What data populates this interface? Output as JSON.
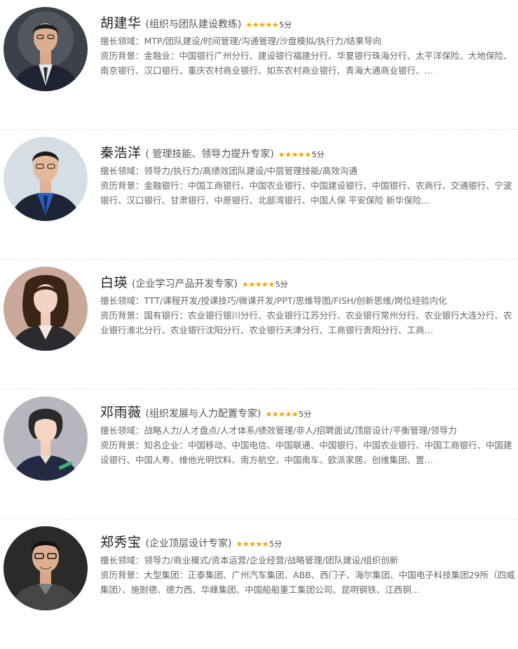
{
  "trainers": [
    {
      "name": "胡建华",
      "title": "(组织与团队建设教练)",
      "stars": "★★★★★",
      "score": "5分",
      "expertise_label": "擅长领域：",
      "expertise": "MTP/团队建设/时间管理/沟通管理/沙盘模拟/执行力/结果导向",
      "background_label": "资历背景：",
      "background": "金融业：中国银行广州分行、建设银行福建分行、华夏银行珠海分行、太平洋保险、大地保险、南京银行、汉口银行、重庆农村商业银行、如东农村商业银行、青海大通商业银行、…"
    },
    {
      "name": "秦浩洋",
      "title": "( 管理技能、领导力提升专家)",
      "stars": "★★★★★",
      "score": "5分",
      "expertise_label": "擅长领域：",
      "expertise": "领导力/执行力/高绩效团队建设/中层管理技能/高效沟通",
      "background_label": "资历背景：",
      "background": "金融银行：中国工商银行、中国农业银行、中国建设银行、中国银行、农商行、交通银行、宁波银行、汉口银行、甘肃银行、中原银行、北部湾银行、中国人保 平安保险 新华保险…"
    },
    {
      "name": "白瑛",
      "title": "(企业学习产品开发专家)",
      "stars": "★★★★★",
      "score": "5分",
      "expertise_label": "擅长领域：",
      "expertise": "TTT/课程开发/授课技巧/微课开发/PPT/思维导图/FISH/创新思维/岗位经验内化",
      "background_label": "资历背景：",
      "background": "国有银行：农业银行银川分行、农业银行江苏分行、农业银行常州分行、农业银行大连分行、农业银行淮北分行、农业银行沈阳分行、农业银行天津分行、工商银行贵阳分行、工商…"
    },
    {
      "name": "邓雨薇",
      "title": "(组织发展与人力配置专家)",
      "stars": "★★★★★",
      "score": "5分",
      "expertise_label": "擅长领域：",
      "expertise": "战略人力/人才盘点/人才体系/绩效管理/非人/招聘面试/顶层设计/平衡管理/领导力",
      "background_label": "资历背景：",
      "background": "知名企业：中国移动、中国电信、中国联通、中国银行、中国农业银行、中国工商银行、中国建设银行、中国人寿、维他光明饮料、南方航空、中国南车、欧派家居、创维集团、置…"
    },
    {
      "name": "郑秀宝",
      "title": "(企业顶层设计专家)",
      "stars": "★★★★★",
      "score": "5分",
      "expertise_label": "擅长领域：",
      "expertise": "领导力/商业模式/资本运营/企业经营/战略管理/团队建设/组织创新",
      "background_label": "资历背景：",
      "background": "大型集团：正泰集团、广州汽车集团、ABB、西门子、海尔集团、中国电子科技集团29所（四威集团）、施耐德、德力西、华峰集团、中国船舶重工集团公司、昆明钢铁、江西铜…"
    }
  ]
}
